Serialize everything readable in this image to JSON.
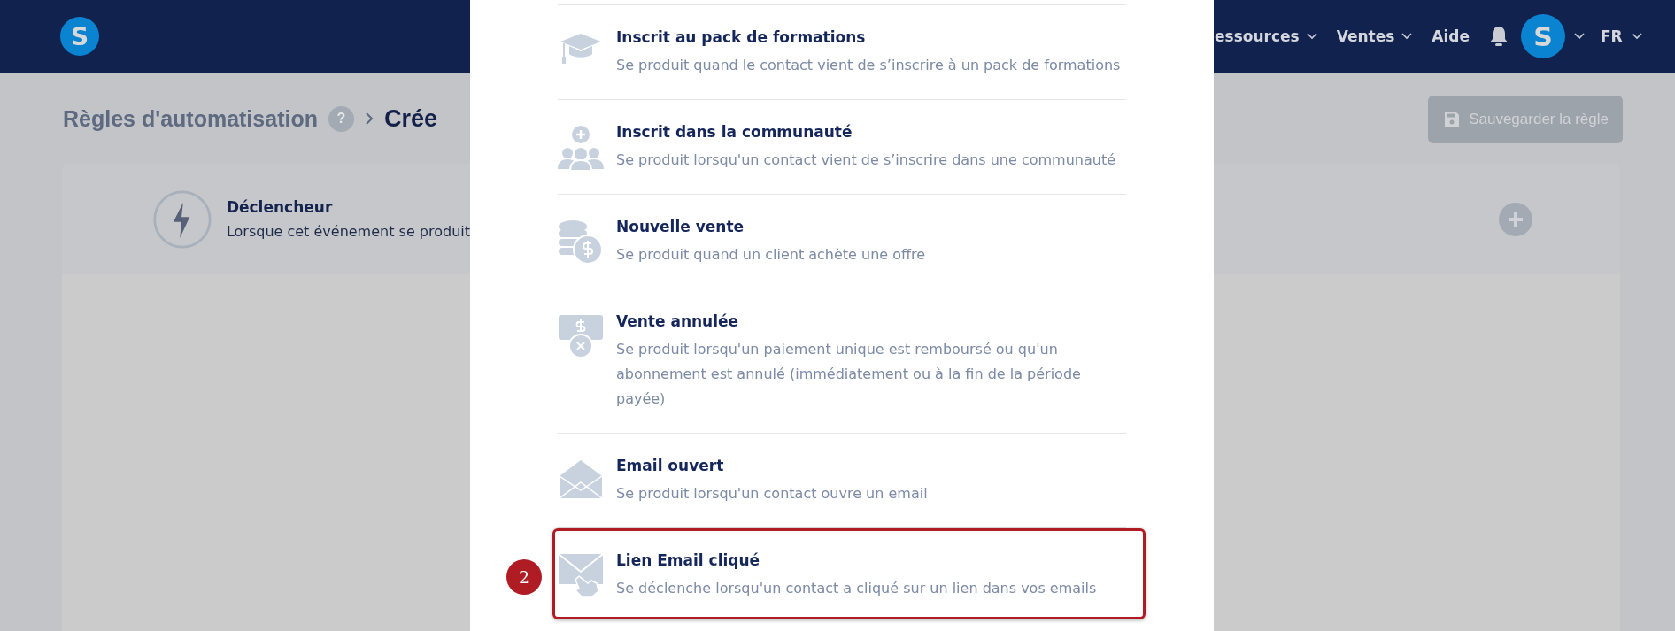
{
  "header": {
    "logo": "S",
    "nav": [
      {
        "label": "essources",
        "dropdown": true
      },
      {
        "label": "Ventes",
        "dropdown": true
      },
      {
        "label": "Aide",
        "dropdown": false
      }
    ],
    "avatar": "S",
    "language": "FR"
  },
  "breadcrumb": {
    "parent": "Règles d'automatisation",
    "help": "?",
    "current": "Crée"
  },
  "save_button": "Sauvegarder la règle",
  "trigger_card": {
    "title": "Déclencheur",
    "description": "Lorsque cet événement se produit"
  },
  "modal": {
    "items": [
      {
        "kind": "course",
        "title": "Inscrit au pack de formations",
        "description": "Se produit quand le contact vient de s’inscrire à un pack de formations",
        "selected": false
      },
      {
        "kind": "community",
        "title": "Inscrit dans la communauté",
        "description": "Se produit lorsqu'un contact vient de s’inscrire dans une communauté",
        "selected": false
      },
      {
        "kind": "sale",
        "title": "Nouvelle vente",
        "description": "Se produit quand un client achète une offre",
        "selected": false
      },
      {
        "kind": "cancel",
        "title": "Vente annulée",
        "description": "Se produit lorsqu'un paiement unique est remboursé ou qu'un abonnement est annulé (immédiatement ou à la fin de la période payée)",
        "selected": false
      },
      {
        "kind": "email_open",
        "title": "Email ouvert",
        "description": "Se produit lorsqu'un contact ouvre un email",
        "selected": false
      },
      {
        "kind": "email_click",
        "title": "Lien Email cliqué",
        "description": "Se déclenche lorsqu'un contact a cliqué sur un lien dans vos emails",
        "selected": true,
        "callout": "2"
      }
    ]
  }
}
